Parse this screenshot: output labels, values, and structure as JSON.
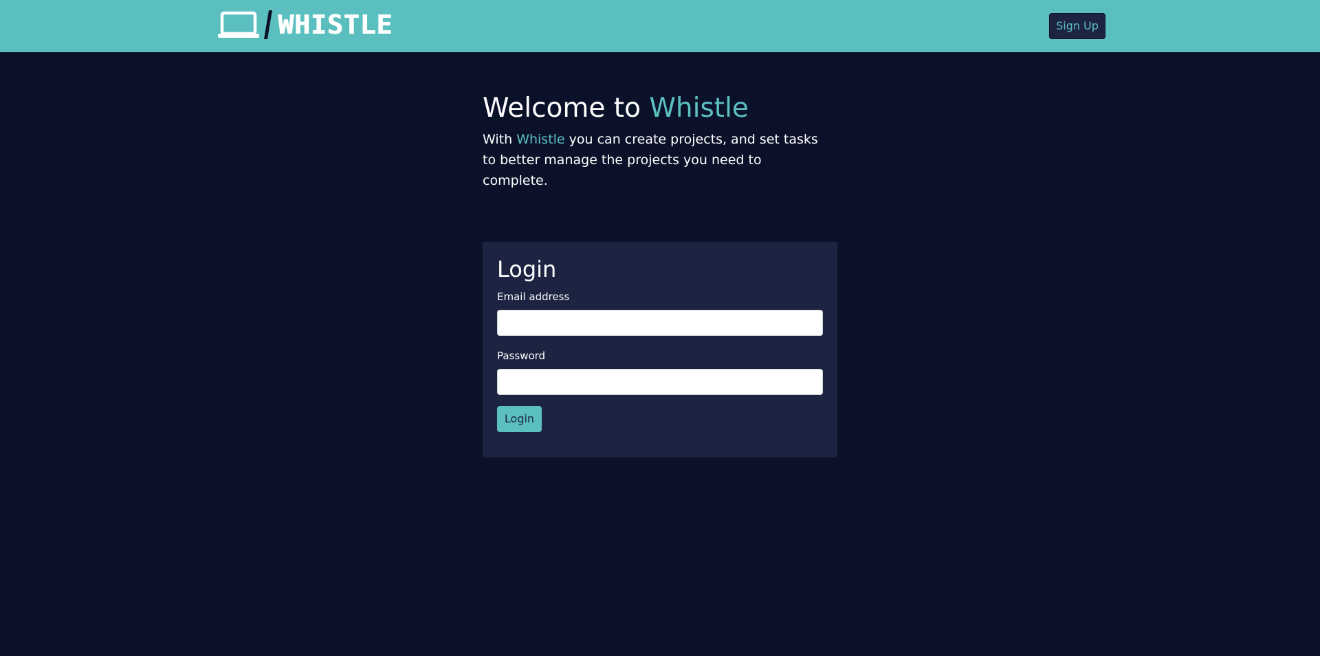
{
  "colors": {
    "navbar": "#5bbfbf",
    "background": "#0b1129",
    "card": "#1c2442",
    "accent": "#5bbfbf",
    "text": "#ffffff"
  },
  "header": {
    "logo_icon": "laptop-icon",
    "logo_text": "WHISTLE",
    "signup_label": "Sign Up"
  },
  "hero": {
    "title_prefix": "Welcome to ",
    "title_brand": "Whistle",
    "desc_prefix": "With ",
    "desc_brand": "Whistle",
    "desc_suffix": " you can create projects, and set tasks to better manage the projects you need to complete."
  },
  "login": {
    "title": "Login",
    "email_label": "Email address",
    "email_value": "",
    "password_label": "Password",
    "password_value": "",
    "submit_label": "Login"
  }
}
